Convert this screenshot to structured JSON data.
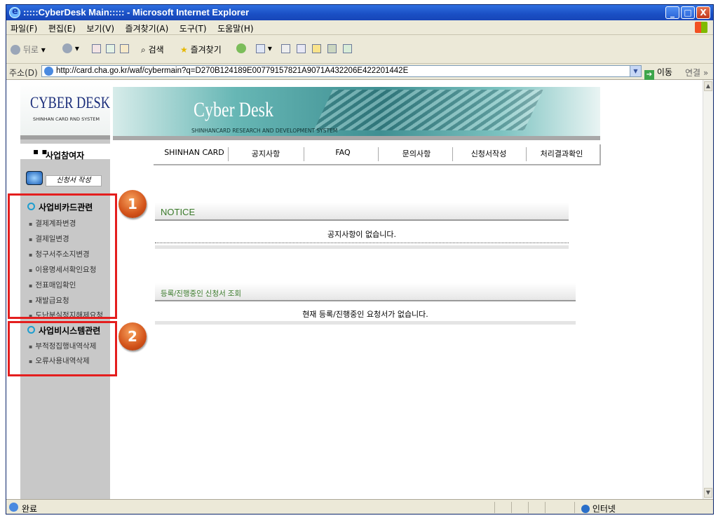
{
  "window": {
    "title": ":::::CyberDesk Main::::: - Microsoft Internet Explorer",
    "minimize": "_",
    "maximize": "□",
    "close": "X"
  },
  "menu": [
    "파일(F)",
    "편집(E)",
    "보기(V)",
    "즐겨찾기(A)",
    "도구(T)",
    "도움말(H)"
  ],
  "toolbar": {
    "back": "뒤로",
    "search": "검색",
    "favorites": "즐겨찾기"
  },
  "address": {
    "label": "주소(D)",
    "url": "http://card.cha.go.kr/waf/cybermain?q=D270B124189E00779157821A9071A432206E422201442E",
    "go": "이동",
    "links": "연결"
  },
  "logo": {
    "title": "CYBER DESK",
    "subtitle": "SHINHAN CARD RND SYSTEM"
  },
  "banner": {
    "title": "Cyber Desk",
    "subtitle": "SHINHANCARD RESEARCH AND DEVELOPMENT SYSTEM"
  },
  "sidebar": {
    "header": "사업참여자",
    "write_button": "신청서 작성",
    "group1": {
      "title": "사업비카드관련",
      "items": [
        "결제계좌변경",
        "결제일변경",
        "청구서주소지변경",
        "이용명세서확인요청",
        "전표매입확인",
        "재발급요청",
        "도난분실정지해제요청"
      ]
    },
    "group2": {
      "title": "사업비시스템관련",
      "items": [
        "부적정집행내역삭제",
        "오류사용내역삭제"
      ]
    }
  },
  "annotations": {
    "badge1": "1",
    "badge2": "2",
    "highlight_color": "#e41e1e"
  },
  "tabs": [
    "SHINHAN CARD",
    "공지사항",
    "FAQ",
    "문의사항",
    "신청서작성",
    "처리결과확인"
  ],
  "notice": {
    "title": "NOTICE",
    "empty": "공지사항이 없습니다."
  },
  "requests": {
    "title": "등록/진행중인 신청서 조회",
    "empty": "현재 등록/진행중인 요청서가 없습니다."
  },
  "status": {
    "text": "완료",
    "zone": "인터넷"
  }
}
